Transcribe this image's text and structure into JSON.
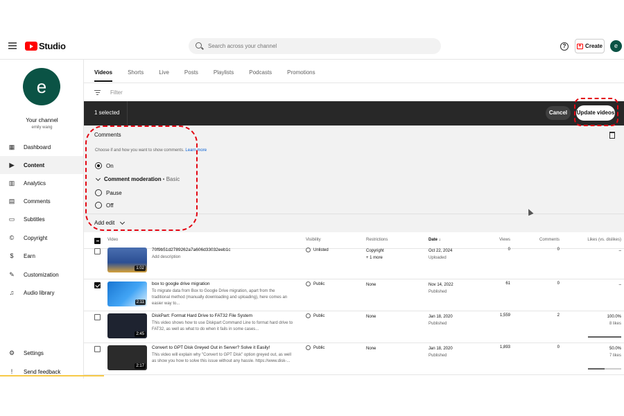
{
  "header": {
    "logo_text": "Studio",
    "search_placeholder": "Search across your channel",
    "help_label": "?",
    "create_label": "Create",
    "avatar_letter": "e"
  },
  "sidebar": {
    "avatar_letter": "e",
    "channel_title": "Your channel",
    "channel_user": "emily wang",
    "items": [
      {
        "label": "Dashboard",
        "icon": "dashboard-icon",
        "glyph": "▦"
      },
      {
        "label": "Content",
        "icon": "content-icon",
        "glyph": "▶"
      },
      {
        "label": "Analytics",
        "icon": "analytics-icon",
        "glyph": "▥"
      },
      {
        "label": "Comments",
        "icon": "comments-icon",
        "glyph": "▤"
      },
      {
        "label": "Subtitles",
        "icon": "subtitles-icon",
        "glyph": "▭"
      },
      {
        "label": "Copyright",
        "icon": "copyright-icon",
        "glyph": "©"
      },
      {
        "label": "Earn",
        "icon": "earn-icon",
        "glyph": "$"
      },
      {
        "label": "Customization",
        "icon": "customization-icon",
        "glyph": "✎"
      },
      {
        "label": "Audio library",
        "icon": "audio-library-icon",
        "glyph": "♫"
      },
      {
        "label": "Settings",
        "icon": "settings-icon",
        "glyph": "⚙"
      },
      {
        "label": "Send feedback",
        "icon": "feedback-icon",
        "glyph": "!"
      }
    ]
  },
  "tabs": [
    "Videos",
    "Shorts",
    "Live",
    "Posts",
    "Playlists",
    "Podcasts",
    "Promotions"
  ],
  "filter": {
    "label": "Filter"
  },
  "selection_bar": {
    "count_text": "1 selected",
    "cancel_label": "Cancel",
    "update_label": "Update videos"
  },
  "edit_panel": {
    "title": "Comments",
    "help_text": "Choose if and how you want to show comments.",
    "learn_more": "Learn more",
    "option_on": "On",
    "moderation_label": "Comment moderation",
    "moderation_value": "• Basic",
    "option_pause": "Pause",
    "option_off": "Off",
    "add_edit_label": "Add edit"
  },
  "table": {
    "headers": {
      "video": "Video",
      "visibility": "Visibility",
      "restrictions": "Restrictions",
      "date": "Date ↓",
      "views": "Views",
      "comments": "Comments",
      "likes": "Likes (vs. dislikes)"
    },
    "rows": [
      {
        "title": "70f9b51d2789262a7a606d33032eeb1c",
        "description": "Add description",
        "duration": "1:02",
        "visibility": "Unlisted",
        "restriction_1": "Copyright",
        "restriction_2": "+ 1 more",
        "date": "Oct 22, 2024",
        "status": "Uploaded",
        "views": "0",
        "comments": "0",
        "likes": "–",
        "likes_count": "",
        "checked": false
      },
      {
        "title": "box to google drive migration",
        "description": "To migrate data from Box to Google Drive migration, apart from the traditional method (manually downloading and uploading), here comes an easier way to...",
        "duration": "2:11",
        "visibility": "Public",
        "restriction_1": "None",
        "restriction_2": "",
        "date": "Nov 14, 2022",
        "status": "Published",
        "views": "61",
        "comments": "0",
        "likes": "–",
        "likes_count": "",
        "checked": true
      },
      {
        "title": "DiskPart: Format Hard Drive to FAT32 File System",
        "description": "This video shows how to use Diskpart Command Line to format hard drive to FAT32, as well as what to do when it fails in some cases...",
        "duration": "2:45",
        "visibility": "Public",
        "restriction_1": "None",
        "restriction_2": "",
        "date": "Jan 18, 2020",
        "status": "Published",
        "views": "1,559",
        "comments": "2",
        "likes": "100.0%",
        "likes_count": "8 likes",
        "like_ratio": 1.0,
        "checked": false
      },
      {
        "title": "Convert to GPT Disk Greyed Out in Server? Solve it Easily!",
        "description": "This video will explain why \"Convert to GPT Disk\" option greyed out, as well as show you how to solve this issue without any hassle. https://www.disk-...",
        "duration": "2:17",
        "visibility": "Public",
        "restriction_1": "None",
        "restriction_2": "",
        "date": "Jan 18, 2020",
        "status": "Published",
        "views": "1,893",
        "comments": "0",
        "likes": "50.0%",
        "likes_count": "7 likes",
        "like_ratio": 0.5,
        "checked": false
      }
    ]
  },
  "colors": {
    "brand_red": "#ff0000",
    "avatar_green": "#0b5345",
    "annotation_red": "#e30613",
    "link_blue": "#065fd4"
  }
}
